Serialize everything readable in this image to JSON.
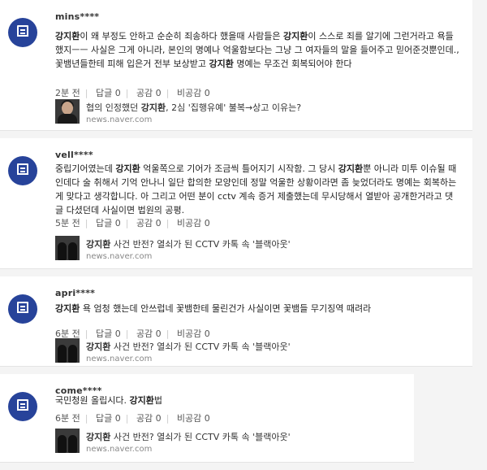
{
  "comments": [
    {
      "nick": "mins****",
      "body_parts": [
        {
          "b": "강지환"
        },
        {
          "t": "이 왜 부정도 안하고 순순히 죄송하다 했을때 사람들은 "
        },
        {
          "b": "강지환"
        },
        {
          "t": "이 스스로 죄를 알기에 그런거라고 욕들 했지ㅡㅡ 사실은 그게 아니라, 본인의 명예나 억울함보다는 그냥 그 여자들의 말을 들어주고 믿어준것뿐인데., 꽃뱀년들한테 피해 입은거 전부 보상받고 "
        },
        {
          "b": "강지환"
        },
        {
          "t": " 명예는 무조건 회복되어야 한다"
        }
      ],
      "time": "2분 전",
      "reply": "답글 0",
      "like": "공감 0",
      "dislike": "비공감 0",
      "link": {
        "title_pre": "협의 인정했던 ",
        "title_bold": "강지환",
        "title_post": ", 2심 '집행유예' 불복→상고 이유는?",
        "url": "news.naver.com"
      },
      "thumb": "single"
    },
    {
      "nick": "vell****",
      "body_parts": [
        {
          "t": "중립기어였는데 "
        },
        {
          "b": "강지환"
        },
        {
          "t": " 억울쪽으로 기어가 조금씩 틀어지기 시작함. 그 당시 "
        },
        {
          "b": "강지환"
        },
        {
          "t": "뿐 아니라 미투 이슈될 때인데다 술 취해서 기억 안나니 일단 합의한 모양인데 정말 억울한 상황이라면 좀 늦었더라도 명예는 회복하는게 맞다고 생각합니다. 아 그리고 어떤 분이 cctv 계속 증거 제출했는데 무시당해서 열받아 공개한거라고 댓글 다셨던데 사실이면 법원의 공평."
        }
      ],
      "time": "5분 전",
      "reply": "답글 0",
      "like": "공감 0",
      "dislike": "비공감 0",
      "link": {
        "title_pre": "",
        "title_bold": "강지환",
        "title_post": " 사건 반전? 열쇠가 된 CCTV 카톡 속 '블랙아웃'",
        "url": "news.naver.com"
      },
      "thumb": "pair"
    },
    {
      "nick": "apri****",
      "body_parts": [
        {
          "b": "강지환"
        },
        {
          "t": " 욕 엄청 했는데 안쓰럽네 꽃뱀한테 물린건가 사실이면 꽃뱀들 무기징역 때려라"
        }
      ],
      "time": "6분 전",
      "reply": "답글 0",
      "like": "공감 0",
      "dislike": "비공감 0",
      "link": {
        "title_pre": "",
        "title_bold": "강지환",
        "title_post": " 사건 반전? 열쇠가 된 CCTV 카톡 속 '블랙아웃'",
        "url": "news.naver.com"
      },
      "thumb": "pair"
    },
    {
      "nick": "come****",
      "body_parts": [
        {
          "t": "국민청원 올립시다. "
        },
        {
          "b": "강지환"
        },
        {
          "t": "법"
        }
      ],
      "time": "6분 전",
      "reply": "답글 0",
      "like": "공감 0",
      "dislike": "비공감 0",
      "link": {
        "title_pre": "",
        "title_bold": "강지환",
        "title_post": " 사건 반전? 열쇠가 된 CCTV 카톡 속 '블랙아웃'",
        "url": "news.naver.com"
      },
      "thumb": "pair"
    }
  ],
  "colors": {
    "avatar": "#27439a",
    "background": "#f4f4f4"
  },
  "icons": {
    "avatar": "news-document-icon"
  }
}
